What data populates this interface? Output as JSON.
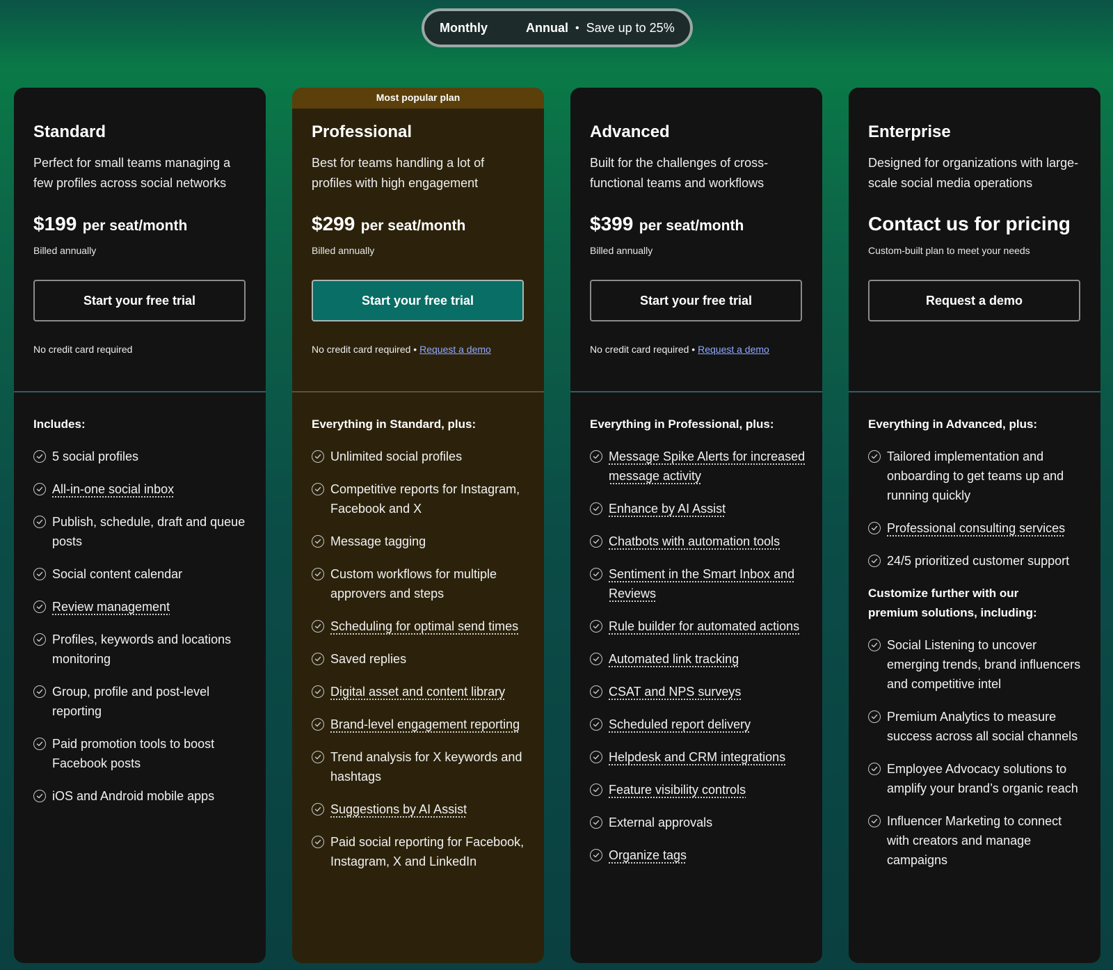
{
  "toggle": {
    "monthly": "Monthly",
    "annual": "Annual",
    "save": "Save up to 25%"
  },
  "plans": [
    {
      "name": "Standard",
      "description": "Perfect for small teams managing a few profiles across social networks",
      "price": "$199",
      "price_unit": "per seat/month",
      "billing": "Billed annually",
      "cta": "Start your free trial",
      "note": "No credit card required",
      "features_heading": "Includes:",
      "features": [
        {
          "text": "5 social profiles",
          "dotted": false
        },
        {
          "text": "All-in-one social inbox",
          "dotted": true
        },
        {
          "text": "Publish, schedule, draft and queue posts",
          "dotted": false
        },
        {
          "text": "Social content calendar",
          "dotted": false
        },
        {
          "text": "Review management",
          "dotted": true
        },
        {
          "text": "Profiles, keywords and locations monitoring",
          "dotted": false
        },
        {
          "text": "Group, profile and post-level reporting",
          "dotted": false
        },
        {
          "text": "Paid promotion tools to boost Facebook posts",
          "dotted": false
        },
        {
          "text": "iOS and Android mobile apps",
          "dotted": false
        }
      ]
    },
    {
      "name": "Professional",
      "banner": "Most popular plan",
      "description": "Best for teams handling a lot of profiles with high engagement",
      "price": "$299",
      "price_unit": "per seat/month",
      "billing": "Billed annually",
      "cta": "Start your free trial",
      "note": "No credit card required",
      "note_link": "Request a demo",
      "features_heading": "Everything in Standard, plus:",
      "features": [
        {
          "text": "Unlimited social profiles",
          "dotted": false
        },
        {
          "text": "Competitive reports for Instagram, Facebook and X",
          "dotted": false
        },
        {
          "text": "Message tagging",
          "dotted": false
        },
        {
          "text": "Custom workflows for multiple approvers and steps",
          "dotted": false
        },
        {
          "text": "Scheduling for optimal send times",
          "dotted": true
        },
        {
          "text": "Saved replies",
          "dotted": false
        },
        {
          "text": "Digital asset and content library",
          "dotted": true
        },
        {
          "text": "Brand-level engagement reporting",
          "dotted": true
        },
        {
          "text": "Trend analysis for X keywords and hashtags",
          "dotted": false
        },
        {
          "text": "Suggestions by AI Assist",
          "dotted": true
        },
        {
          "text": "Paid social reporting for Facebook, Instagram, X and LinkedIn",
          "dotted": false
        }
      ]
    },
    {
      "name": "Advanced",
      "description": "Built for the challenges of cross-functional teams and workflows",
      "price": "$399",
      "price_unit": "per seat/month",
      "billing": "Billed annually",
      "cta": "Start your free trial",
      "note": "No credit card required",
      "note_link": "Request a demo",
      "features_heading": "Everything in Professional, plus:",
      "features": [
        {
          "text": "Message Spike Alerts for increased message activity",
          "dotted": true
        },
        {
          "text": "Enhance by AI Assist",
          "dotted": true
        },
        {
          "text": "Chatbots with automation tools",
          "dotted": true
        },
        {
          "text": "Sentiment in the Smart Inbox and Reviews",
          "dotted": true
        },
        {
          "text": "Rule builder for automated actions",
          "dotted": true
        },
        {
          "text": "Automated link tracking",
          "dotted": true
        },
        {
          "text": "CSAT and NPS surveys",
          "dotted": true
        },
        {
          "text": "Scheduled report delivery",
          "dotted": true
        },
        {
          "text": "Helpdesk and CRM integrations",
          "dotted": true
        },
        {
          "text": "Feature visibility controls",
          "dotted": true
        },
        {
          "text": "External approvals",
          "dotted": false
        },
        {
          "text": "Organize tags",
          "dotted": true
        }
      ]
    },
    {
      "name": "Enterprise",
      "description": "Designed for organizations with large-scale social media operations",
      "contact": "Contact us for pricing",
      "billing": "Custom-built plan to meet your needs",
      "cta": "Request a demo",
      "features_heading": "Everything in Advanced, plus:",
      "features": [
        {
          "text": "Tailored implementation and onboarding to get teams up and running quickly",
          "dotted": false
        },
        {
          "text": "Professional consulting services",
          "dotted": true
        },
        {
          "text": "24/5 prioritized customer support",
          "dotted": false
        }
      ],
      "premium_heading": "Customize further with our premium solutions, including:",
      "premium_features": [
        {
          "text": "Social Listening to uncover emerging trends, brand influencers and competitive intel",
          "dotted": false
        },
        {
          "text": "Premium Analytics to measure success across all social channels",
          "dotted": false
        },
        {
          "text": "Employee Advocacy solutions to amplify your brand’s organic reach",
          "dotted": false
        },
        {
          "text": "Influencer Marketing to connect with creators and manage campaigns",
          "dotted": false
        }
      ]
    }
  ],
  "colors": {
    "card_bg": "#131313",
    "popular_card_bg": "#2c220b",
    "popular_banner": "#5b400b",
    "primary_cta": "#086e66",
    "link": "#8fa8ff"
  }
}
